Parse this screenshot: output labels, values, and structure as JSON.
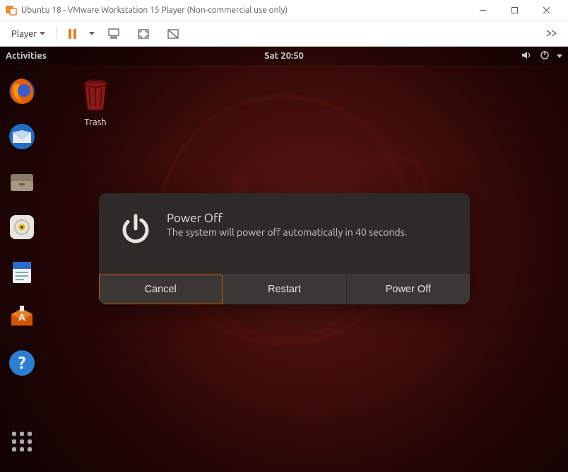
{
  "window": {
    "title": "Ubuntu 18 - VMware Workstation 15 Player (Non-commercial use only)"
  },
  "vm_toolbar": {
    "player_label": "Player"
  },
  "ubuntu_topbar": {
    "activities": "Activities",
    "clock": "Sat 20:50"
  },
  "desktop": {
    "trash_label": "Trash"
  },
  "dialog": {
    "title": "Power Off",
    "message": "The system will power off automatically in 40 seconds.",
    "buttons": {
      "cancel": "Cancel",
      "restart": "Restart",
      "poweroff": "Power Off"
    }
  }
}
